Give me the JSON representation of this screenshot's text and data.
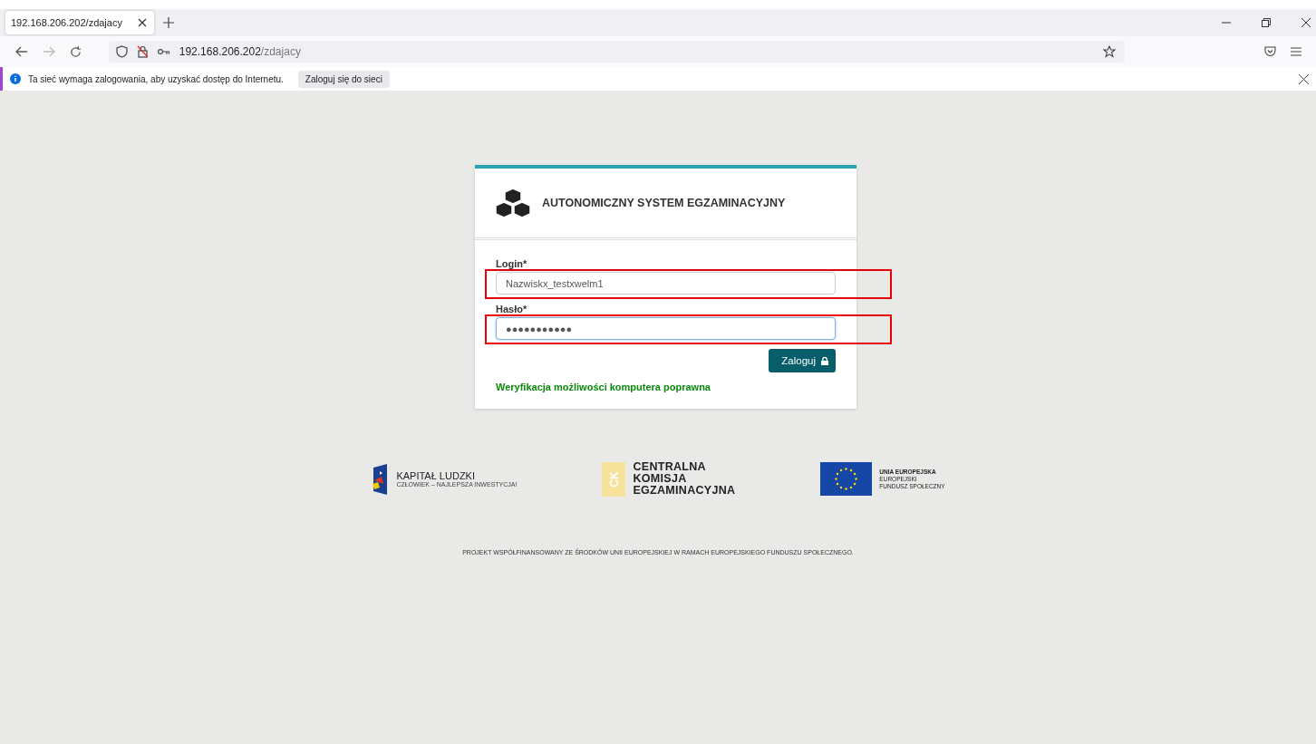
{
  "tabs": [
    {
      "label": "192.168.206.202/zdajacy",
      "selected": true
    }
  ],
  "address_bar": {
    "host": "192.168.206.202",
    "path": "/zdajacy"
  },
  "notification": {
    "message": "Ta sieć wymaga zalogowania, aby uzyskać dostęp do Internetu.",
    "button": "Zaloguj się do sieci"
  },
  "login_card": {
    "title": "AUTONOMICZNY SYSTEM EGZAMINACYJNY",
    "fields": [
      {
        "label": "Login*",
        "value": "Nazwiskx_testxwelm1",
        "focused": false
      },
      {
        "label": "Hasło*",
        "value": "●●●●●●●●●●●",
        "focused": true
      }
    ],
    "submit": "Zaloguj",
    "status": "Weryfikacja możliwości komputera poprawna"
  },
  "logos": {
    "kapital_ludzki": {
      "name": "KAPITAŁ LUDZKI",
      "tagline": "CZŁOWIEK – NAJLEPSZA INWESTYCJA!"
    },
    "cke": {
      "mark": "CK",
      "lines": [
        "CENTRALNA",
        "KOMISJA",
        "EGZAMINACYJNA"
      ]
    },
    "ue": {
      "lines": [
        "UNIA EUROPEJSKA",
        "EUROPEJSKI",
        "FUNDUSZ SPOŁECZNY"
      ]
    }
  },
  "footer": "PROJEKT WSPÓŁFINANSOWANY ZE ŚRODKÓW UNII EUROPEJSKIEJ W RAMACH EUROPEJSKIEGO FUNDUSZU SPOŁECZNEGO."
}
